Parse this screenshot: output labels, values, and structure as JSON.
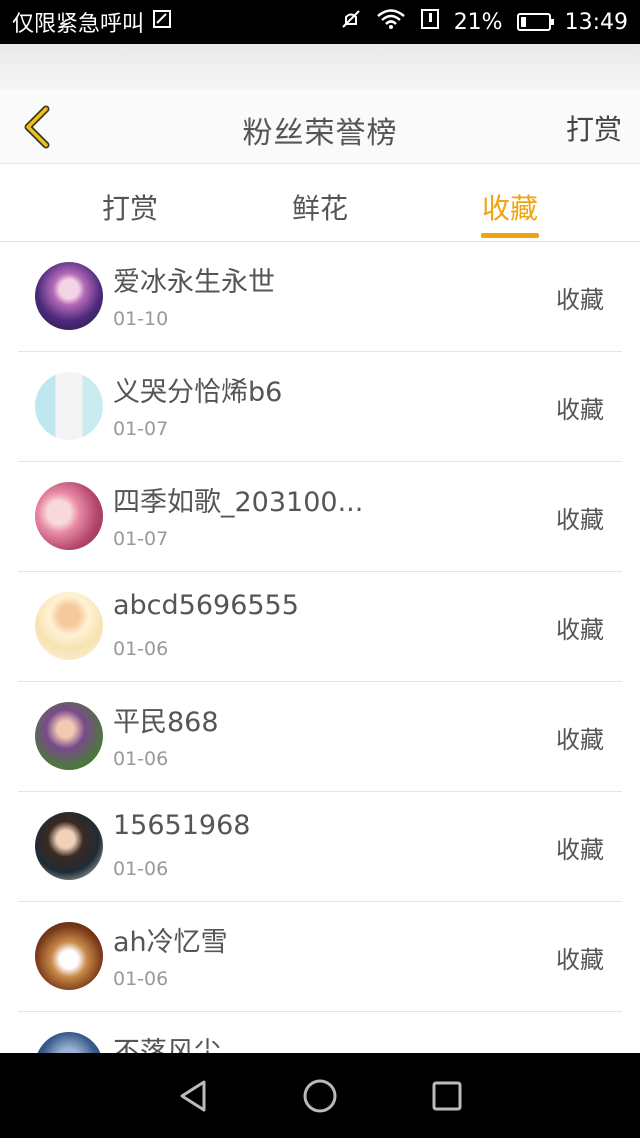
{
  "status_bar": {
    "carrier_text": "仅限紧急呼叫",
    "battery_percent": "21%",
    "battery_level": 0.21,
    "time": "13:49",
    "icons": [
      "sim-icon",
      "mute-icon",
      "wifi-icon",
      "data-icon",
      "battery-icon"
    ]
  },
  "header": {
    "title": "粉丝荣誉榜",
    "action_label": "打赏",
    "accent_color": "#f0a40f"
  },
  "tabs": [
    {
      "label": "打赏",
      "active": false
    },
    {
      "label": "鲜花",
      "active": false
    },
    {
      "label": "收藏",
      "active": true
    }
  ],
  "fans": [
    {
      "name": "爱冰永生永世",
      "date": "01-10",
      "action": "收藏"
    },
    {
      "name": "义哭分恰烯b6",
      "date": "01-07",
      "action": "收藏"
    },
    {
      "name": "四季如歌_203100...",
      "date": "01-07",
      "action": "收藏"
    },
    {
      "name": "abcd5696555",
      "date": "01-06",
      "action": "收藏"
    },
    {
      "name": "平民868",
      "date": "01-06",
      "action": "收藏"
    },
    {
      "name": "15651968",
      "date": "01-06",
      "action": "收藏"
    },
    {
      "name": "ah冷忆雪",
      "date": "01-06",
      "action": "收藏"
    },
    {
      "name": "不落风尘",
      "date": "",
      "action": ""
    }
  ]
}
